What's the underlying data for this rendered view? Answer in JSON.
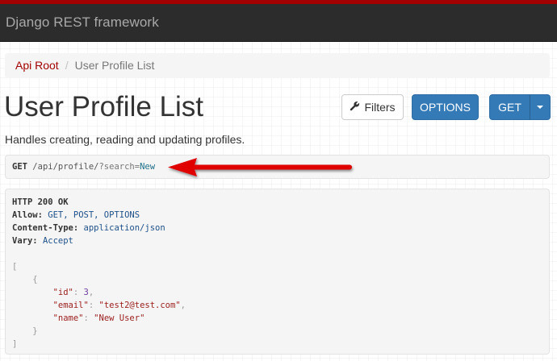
{
  "navbar": {
    "brand": "Django REST framework"
  },
  "breadcrumb": {
    "items": [
      "Api Root",
      "User Profile List"
    ],
    "separator": "/"
  },
  "page": {
    "title": "User Profile List",
    "description": "Handles creating, reading and updating profiles."
  },
  "toolbar": {
    "filters_label": "Filters",
    "options_label": "OPTIONS",
    "get_label": "GET"
  },
  "request": {
    "method": "GET",
    "path": "/api/profile/",
    "query_prefix": "?search",
    "query_eq": "=",
    "query_value": "New"
  },
  "response": {
    "status_line": "HTTP 200 OK",
    "headers": [
      {
        "name": "Allow:",
        "value": "GET, POST, OPTIONS"
      },
      {
        "name": "Content-Type:",
        "value": "application/json"
      },
      {
        "name": "Vary:",
        "value": "Accept"
      }
    ],
    "body": {
      "open_bracket": "[",
      "open_brace": "{",
      "fields": [
        {
          "key": "\"id\"",
          "sep": ": ",
          "value": "3",
          "trail": ","
        },
        {
          "key": "\"email\"",
          "sep": ": ",
          "value": "\"test2@test.com\"",
          "trail": ","
        },
        {
          "key": "\"name\"",
          "sep": ": ",
          "value": "\"New User\"",
          "trail": ""
        }
      ],
      "close_brace": "}",
      "close_bracket": "]"
    }
  },
  "colors": {
    "brand_red": "#a30000",
    "navbar_bg": "#2c2c2c",
    "primary": "#337ab7",
    "annotation_arrow": "#e00000"
  },
  "icons": {
    "filters": "wrench-icon",
    "get_dropdown": "caret-down-icon",
    "annotation": "red-arrow-annotation"
  }
}
